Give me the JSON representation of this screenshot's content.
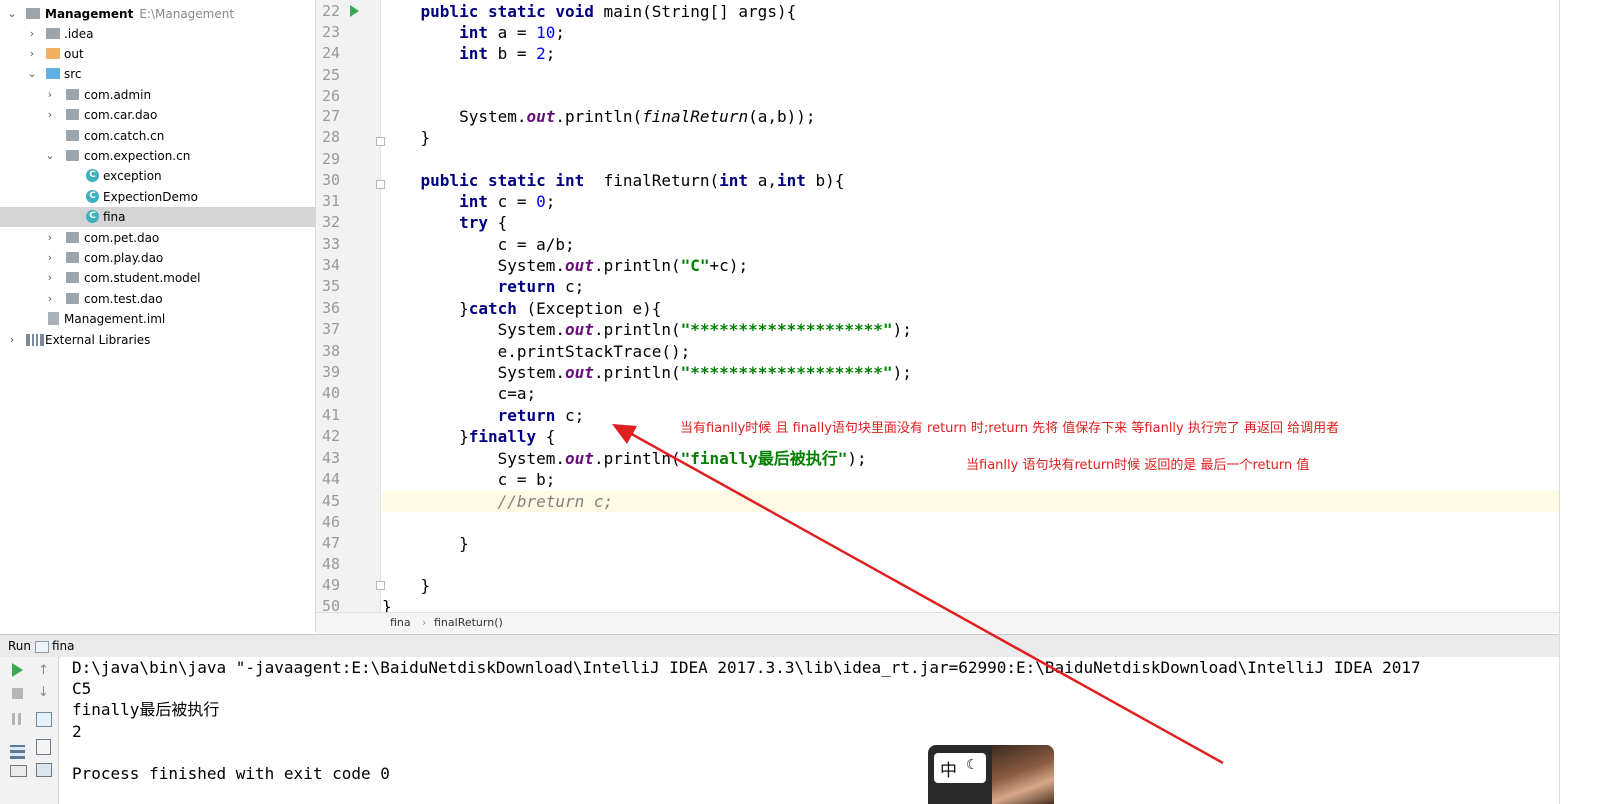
{
  "project_tree": {
    "root": {
      "name": "Management",
      "path": "E:\\Management"
    },
    "items": [
      {
        "label": ".idea"
      },
      {
        "label": "out"
      },
      {
        "label": "src"
      },
      {
        "label": "com.admin"
      },
      {
        "label": "com.car.dao"
      },
      {
        "label": "com.catch.cn"
      },
      {
        "label": "com.expection.cn"
      },
      {
        "label": "exception"
      },
      {
        "label": "ExpectionDemo"
      },
      {
        "label": "fina"
      },
      {
        "label": "com.pet.dao"
      },
      {
        "label": "com.play.dao"
      },
      {
        "label": "com.student.model"
      },
      {
        "label": "com.test.dao"
      },
      {
        "label": "Management.iml"
      },
      {
        "label": "External Libraries"
      }
    ],
    "selected": "fina"
  },
  "editor": {
    "line_numbers": [
      "22",
      "23",
      "24",
      "25",
      "26",
      "27",
      "28",
      "29",
      "30",
      "31",
      "32",
      "33",
      "34",
      "35",
      "36",
      "37",
      "38",
      "39",
      "40",
      "41",
      "42",
      "43",
      "44",
      "45",
      "46",
      "47",
      "48",
      "49",
      "50"
    ],
    "lines": {
      "l22": {
        "a": "    ",
        "kw1": "public static void",
        "b": " main(String[] args){"
      },
      "l23": {
        "a": "        ",
        "kw": "int",
        "b": " a = ",
        "num": "10",
        "c": ";"
      },
      "l24": {
        "a": "        ",
        "kw": "int",
        "b": " b = ",
        "num": "2",
        "c": ";"
      },
      "l27": {
        "a": "        System.",
        "fld": "out",
        "b": ".println(",
        "m": "finalReturn",
        "c": "(a,b));"
      },
      "l28": {
        "a": "    }"
      },
      "l30": {
        "a": "    ",
        "kw1": "public static int",
        "b": "  finalReturn(",
        "kw2": "int",
        "c": " a,",
        "kw3": "int",
        "d": " b){"
      },
      "l31": {
        "a": "        ",
        "kw": "int",
        "b": " c = ",
        "num": "0",
        "c": ";"
      },
      "l32": {
        "a": "        ",
        "kw": "try",
        "b": " {"
      },
      "l33": {
        "a": "            c = a/b;"
      },
      "l34": {
        "a": "            System.",
        "fld": "out",
        "b": ".println(",
        "str": "\"C\"",
        "c": "+c);"
      },
      "l35": {
        "a": "            ",
        "kw": "return",
        "b": " c;"
      },
      "l36": {
        "a": "        }",
        "kw": "catch",
        "b": " (Exception e){"
      },
      "l37": {
        "a": "            System.",
        "fld": "out",
        "b": ".println(",
        "str": "\"********************\"",
        "c": ");"
      },
      "l38": {
        "a": "            e.printStackTrace();"
      },
      "l39": {
        "a": "            System.",
        "fld": "out",
        "b": ".println(",
        "str": "\"********************\"",
        "c": ");"
      },
      "l40": {
        "a": "            c=a;"
      },
      "l41": {
        "a": "            ",
        "kw": "return",
        "b": " c;"
      },
      "l42": {
        "a": "        }",
        "kw": "finally",
        "b": " {"
      },
      "l43": {
        "a": "            System.",
        "fld": "out",
        "b": ".println(",
        "str": "\"finally最后被执行\"",
        "c": ");"
      },
      "l44": {
        "a": "            c = b;"
      },
      "l45": {
        "a": "            ",
        "cmt": "//breturn c;"
      },
      "l47": {
        "a": "        }"
      },
      "l49": {
        "a": "    }"
      },
      "l50": {
        "a": "}"
      }
    },
    "annotations": {
      "note1": "当有fianlly时候 且 finally语句块里面没有 return 时;return 先将 值保存下来 等fianlly 执行完了 再返回 给调用者",
      "note2": "当fianlly 语句块有return时候 返回的是 最后一个return 值"
    },
    "annotation_color": "#e02020"
  },
  "breadcrumb": {
    "class": "fina",
    "method": "finalReturn()"
  },
  "run_panel": {
    "title": "Run",
    "config": "fina",
    "console_lines": [
      "D:\\java\\bin\\java \"-javaagent:E:\\BaiduNetdiskDownload\\IntelliJ IDEA 2017.3.3\\lib\\idea_rt.jar=62990:E:\\BaiduNetdiskDownload\\IntelliJ IDEA 2017",
      "C5",
      "finally最后被执行",
      "2",
      "",
      "Process finished with exit code 0"
    ]
  },
  "ime": {
    "char": "中",
    "mode_icon": "☾"
  }
}
